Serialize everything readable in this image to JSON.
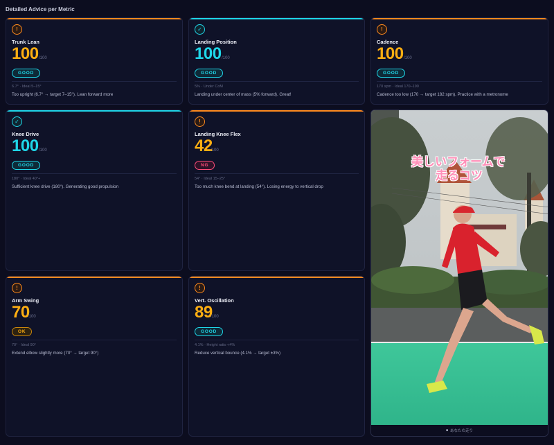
{
  "section_title": "Detailed Advice per Metric",
  "colors": {
    "warn": "#ff8a1e",
    "good": "#1fd6e8",
    "ng": "#ff4d7a",
    "ok": "#ffae12"
  },
  "metrics": [
    {
      "name": "Trunk Lean",
      "icon": "warning-icon",
      "score": "100",
      "max": "/100",
      "status": "GOOD",
      "ideal": "6.7° · Ideal 5–15°",
      "advice": "Too upright (6.7° → target 7–15°). Lean forward more"
    },
    {
      "name": "Landing Position",
      "icon": "check-icon",
      "score": "100",
      "max": "/100",
      "status": "GOOD",
      "ideal": "5% · Under CoM",
      "advice": "Landing under center of mass (5% forward). Great!"
    },
    {
      "name": "Cadence",
      "icon": "warning-icon",
      "score": "100",
      "max": "/100",
      "status": "GOOD",
      "ideal": "170 spm · Ideal 170–190",
      "advice": "Cadence too low (170 → target 182 spm). Practice with a metronome"
    },
    {
      "name": "Knee Drive",
      "icon": "check-icon",
      "score": "100",
      "max": "/100",
      "status": "GOOD",
      "ideal": "180° · Ideal 40°+",
      "advice": "Sufficient knee drive (180°). Generating good propulsion"
    },
    {
      "name": "Landing Knee Flex",
      "icon": "warning-icon",
      "score": "42",
      "max": "/100",
      "status": "NG",
      "ideal": "54° · Ideal 15–25°",
      "advice": "Too much knee bend at landing (54°). Losing energy to vertical drop"
    },
    {
      "name": "Arm Swing",
      "icon": "warning-icon",
      "score": "70",
      "max": "/100",
      "status": "OK",
      "ideal": "70° · Ideal 90°",
      "advice": "Extend elbow slightly more (70° → target 90°)"
    },
    {
      "name": "Vert. Oscillation",
      "icon": "warning-icon",
      "score": "89",
      "max": "/100",
      "status": "GOOD",
      "ideal": "4.1% · Height ratio <4%",
      "advice": "Reduce vertical bounce (4.1% → target ±3%)"
    }
  ],
  "video": {
    "overlay_line1": "美しいフォームで",
    "overlay_line2": "走るコツ",
    "caption": "あなたの走り"
  }
}
